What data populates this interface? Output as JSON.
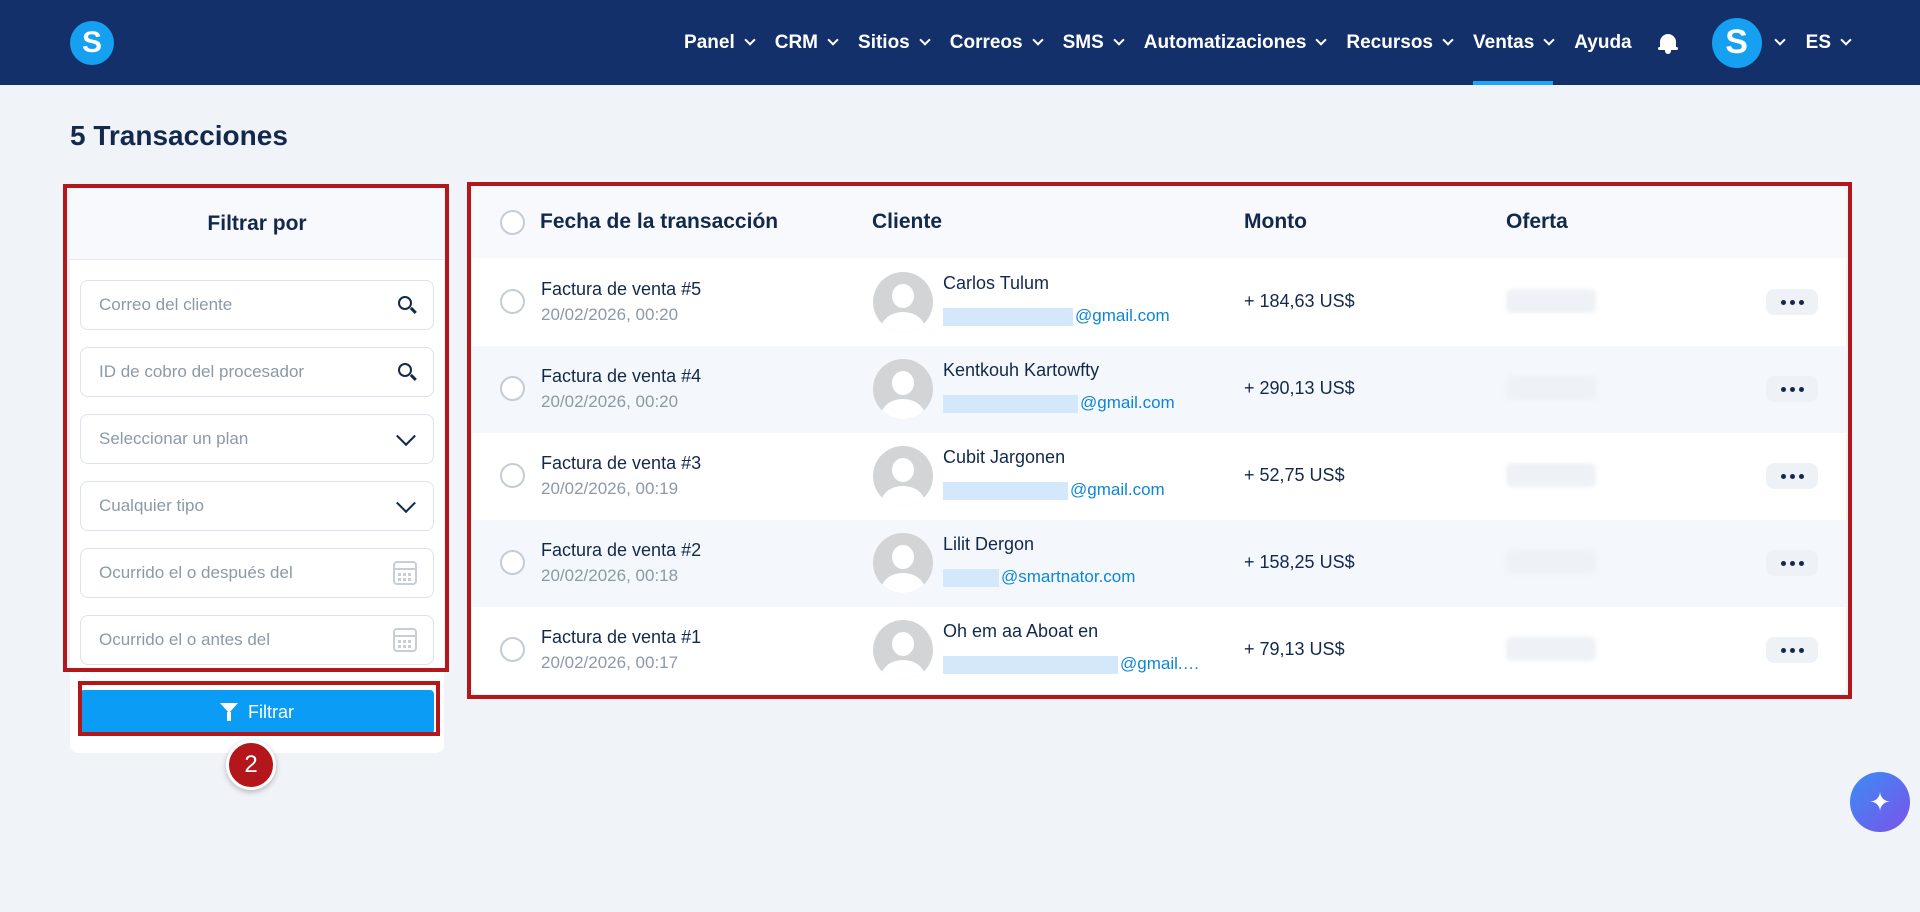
{
  "nav": {
    "logo_letter": "S",
    "items": [
      {
        "label": "Panel",
        "dropdown": true,
        "active": false
      },
      {
        "label": "CRM",
        "dropdown": true,
        "active": false
      },
      {
        "label": "Sitios",
        "dropdown": true,
        "active": false
      },
      {
        "label": "Correos",
        "dropdown": true,
        "active": false
      },
      {
        "label": "SMS",
        "dropdown": true,
        "active": false
      },
      {
        "label": "Automatizaciones",
        "dropdown": true,
        "active": false
      },
      {
        "label": "Recursos",
        "dropdown": true,
        "active": false
      },
      {
        "label": "Ventas",
        "dropdown": true,
        "active": true
      },
      {
        "label": "Ayuda",
        "dropdown": false,
        "active": false
      }
    ],
    "avatar_letter": "S",
    "language": "ES"
  },
  "page": {
    "title": "5 Transacciones"
  },
  "filter": {
    "title": "Filtrar por",
    "fields": [
      {
        "placeholder": "Correo del cliente",
        "icon": "search-icon"
      },
      {
        "placeholder": "ID de cobro del procesador",
        "icon": "search-icon"
      },
      {
        "placeholder": "Seleccionar un plan",
        "icon": "chevron-down-icon"
      },
      {
        "placeholder": "Cualquier tipo",
        "icon": "chevron-down-icon"
      },
      {
        "placeholder": "Ocurrido el o después del",
        "icon": "calendar-icon"
      },
      {
        "placeholder": "Ocurrido el o antes del",
        "icon": "calendar-icon"
      }
    ],
    "button_label": "Filtrar"
  },
  "step_badge": "2",
  "table": {
    "columns": [
      "Fecha de la transacción",
      "Cliente",
      "Monto",
      "Oferta"
    ],
    "rows": [
      {
        "title": "Factura de venta #5",
        "date": "20/02/2026, 00:20",
        "name": "Carlos Tulum",
        "email": "@gmail.com",
        "amount": "+ 184,63 US$"
      },
      {
        "title": "Factura de venta #4",
        "date": "20/02/2026, 00:20",
        "name": "Kentkouh Kartowfty",
        "email": "@gmail.com",
        "amount": "+ 290,13 US$"
      },
      {
        "title": "Factura de venta #3",
        "date": "20/02/2026, 00:19",
        "name": "Cubit Jargonen",
        "email": "@gmail.com",
        "amount": "+ 52,75 US$"
      },
      {
        "title": "Factura de venta #2",
        "date": "20/02/2026, 00:18",
        "name": "Lilit Dergon",
        "email": "@smartnator.com",
        "amount": "+ 158,25 US$"
      },
      {
        "title": "Factura de venta #1",
        "date": "20/02/2026, 00:17",
        "name": "Oh em aa Aboat en",
        "email": "@gmail.…",
        "amount": "+ 79,13 US$"
      }
    ]
  },
  "colors": {
    "nav_bg": "#13306b",
    "accent": "#0b9cf5",
    "highlight": "#b3161b"
  }
}
